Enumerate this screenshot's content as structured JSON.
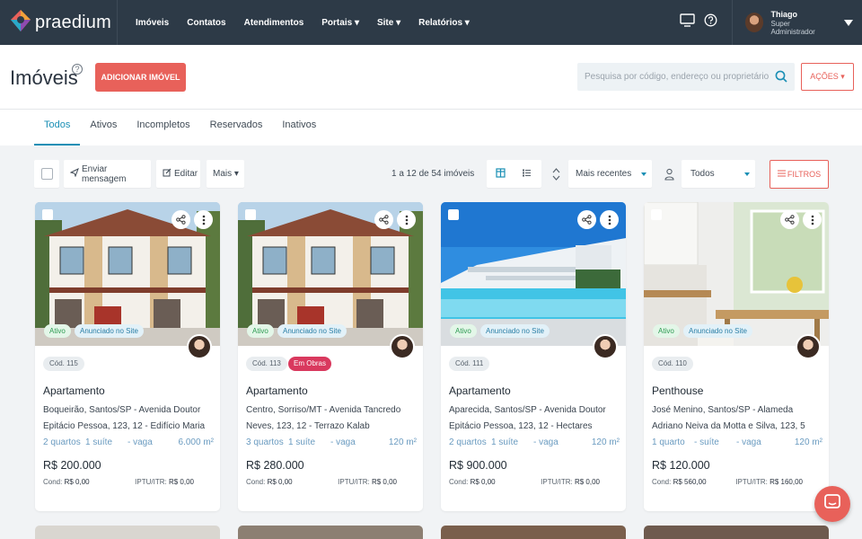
{
  "brand": {
    "name": "praedium"
  },
  "nav": {
    "items": [
      "Imóveis",
      "Contatos",
      "Atendimentos",
      "Portais ▾",
      "Site ▾",
      "Relatórios ▾"
    ],
    "user": {
      "name": "Thiago",
      "role": "Super Administrador"
    }
  },
  "header": {
    "title": "Imóveis",
    "add_button": "ADICIONAR IMÓVEL",
    "search_placeholder": "Pesquisa por código, endereço ou proprietário",
    "actions_button": "AÇÕES ▾"
  },
  "tabs": [
    "Todos",
    "Ativos",
    "Incompletos",
    "Reservados",
    "Inativos"
  ],
  "active_tab": "Todos",
  "toolbar": {
    "send_message": "Enviar mensagem",
    "edit": "Editar",
    "more": "Mais ▾",
    "pagination": "1 a 12 de 54 imóveis",
    "sort": "Mais recentes",
    "owner_filter": "Todos",
    "filters": "FILTROS"
  },
  "listings": [
    {
      "code": "Cód. 115",
      "extra_badge": "",
      "status": "Ativo",
      "site_status": "Anunciado no Site",
      "type": "Apartamento",
      "address": "Boqueirão, Santos/SP - Avenida Doutor Epitácio Pessoa, 123, 12 - Edifício Maria",
      "rooms": "2 quartos",
      "suites": "1 suíte",
      "parking": "- vaga",
      "area": "6.000 m²",
      "price": "R$ 200.000",
      "cond_label": "Cond:",
      "cond": "R$ 0,00",
      "iptu_label": "IPTU/ITR:",
      "iptu": "R$ 0,00"
    },
    {
      "code": "Cód. 113",
      "extra_badge": "Em Obras",
      "status": "Ativo",
      "site_status": "Anunciado no Site",
      "type": "Apartamento",
      "address": "Centro, Sorriso/MT - Avenida Tancredo Neves, 123, 12 - Terrazo Kalab",
      "rooms": "3 quartos",
      "suites": "1 suíte",
      "parking": "- vaga",
      "area": "120 m²",
      "price": "R$ 280.000",
      "cond_label": "Cond:",
      "cond": "R$ 0,00",
      "iptu_label": "IPTU/ITR:",
      "iptu": "R$ 0,00"
    },
    {
      "code": "Cód. 111",
      "extra_badge": "",
      "status": "Ativo",
      "site_status": "Anunciado no Site",
      "type": "Apartamento",
      "address": "Aparecida, Santos/SP - Avenida Doutor Epitácio Pessoa, 123, 12 - Hectares",
      "rooms": "2 quartos",
      "suites": "1 suíte",
      "parking": "- vaga",
      "area": "120 m²",
      "price": "R$ 900.000",
      "cond_label": "Cond:",
      "cond": "R$ 0,00",
      "iptu_label": "IPTU/ITR:",
      "iptu": "R$ 0,00"
    },
    {
      "code": "Cód. 110",
      "extra_badge": "",
      "status": "Ativo",
      "site_status": "Anunciado no Site",
      "type": "Penthouse",
      "address": "José Menino, Santos/SP - Alameda Adriano Neiva da Motta e Silva, 123, 5",
      "rooms": "1 quarto",
      "suites": "- suíte",
      "parking": "- vaga",
      "area": "120 m²",
      "price": "R$ 120.000",
      "cond_label": "Cond:",
      "cond": "R$ 560,00",
      "iptu_label": "IPTU/ITR:",
      "iptu": "R$ 160,00"
    }
  ],
  "colors": {
    "accent": "#e8615a",
    "nav_bg": "#2d3a47",
    "link": "#1a8fb5",
    "badge_obras": "#d9395e"
  },
  "icons": [
    "logo-icon",
    "monitor-icon",
    "help-circle-icon",
    "caret-down-icon",
    "help-icon",
    "search-icon",
    "send-icon",
    "edit-icon",
    "grid-view-icon",
    "list-view-icon",
    "sort-icon",
    "person-icon",
    "filter-icon",
    "share-icon",
    "more-vert-icon",
    "chat-icon"
  ]
}
